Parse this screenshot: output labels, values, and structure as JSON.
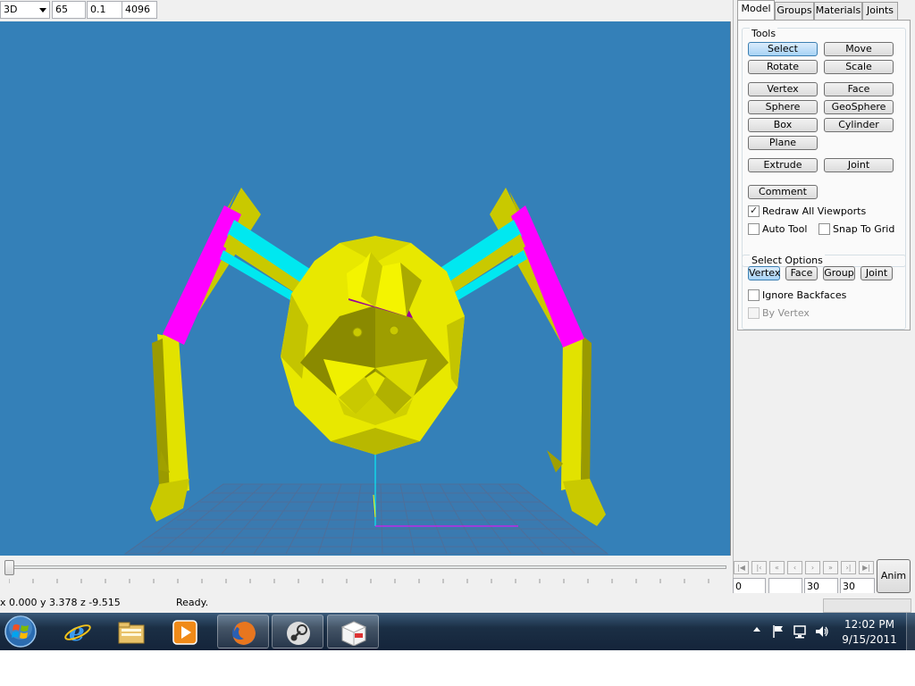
{
  "toolbar": {
    "view_mode": "3D",
    "field_fov": "65",
    "field_near": "0.1",
    "field_far": "4096"
  },
  "tabs": [
    {
      "label": "Model",
      "active": true
    },
    {
      "label": "Groups",
      "active": false
    },
    {
      "label": "Materials",
      "active": false
    },
    {
      "label": "Joints",
      "active": false
    }
  ],
  "tools": {
    "heading": "Tools",
    "select": "Select",
    "move": "Move",
    "rotate": "Rotate",
    "scale": "Scale",
    "vertex": "Vertex",
    "face": "Face",
    "sphere": "Sphere",
    "geosphere": "GeoSphere",
    "box": "Box",
    "cylinder": "Cylinder",
    "plane": "Plane",
    "extrude": "Extrude",
    "joint": "Joint",
    "comment": "Comment",
    "active_tool": "Select",
    "redraw_all_viewports": "Redraw All Viewports",
    "redraw_all_viewports_checked": true,
    "auto_tool": "Auto Tool",
    "auto_tool_checked": false,
    "snap_to_grid": "Snap To Grid",
    "snap_to_grid_checked": false
  },
  "select_options": {
    "heading": "Select Options",
    "vertex": "Vertex",
    "face": "Face",
    "group": "Group",
    "joint": "Joint",
    "active_mode": "Vertex",
    "ignore_backfaces": "Ignore Backfaces",
    "ignore_backfaces_checked": false,
    "by_vertex": "By Vertex",
    "by_vertex_checked": false
  },
  "timeline": {
    "position": 0
  },
  "animation": {
    "frame_start": "0",
    "frame_current": "",
    "frame_count": "30",
    "frame_end": "30",
    "anim_label": "Anim",
    "nav_icons": [
      "first-frame-icon",
      "prev-key-icon",
      "rewind-icon",
      "prev-frame-icon",
      "next-frame-icon",
      "fast-forward-icon",
      "next-key-icon",
      "last-frame-icon"
    ]
  },
  "status": {
    "coords": "x 0.000 y 3.378 z -9.515",
    "message": "Ready."
  },
  "taskbar": {
    "apps": [
      "start-orb",
      "internet-explorer-icon",
      "windows-explorer-icon",
      "media-player-icon",
      "firefox-icon",
      "steam-icon",
      "model-editor-icon"
    ],
    "time": "12:02 PM",
    "date": "9/15/2011"
  },
  "colors": {
    "viewport_bg": "#3480b8",
    "model_yellow": "#e8e800",
    "accent_magenta": "#ff00ff",
    "accent_cyan": "#00e8f0"
  }
}
